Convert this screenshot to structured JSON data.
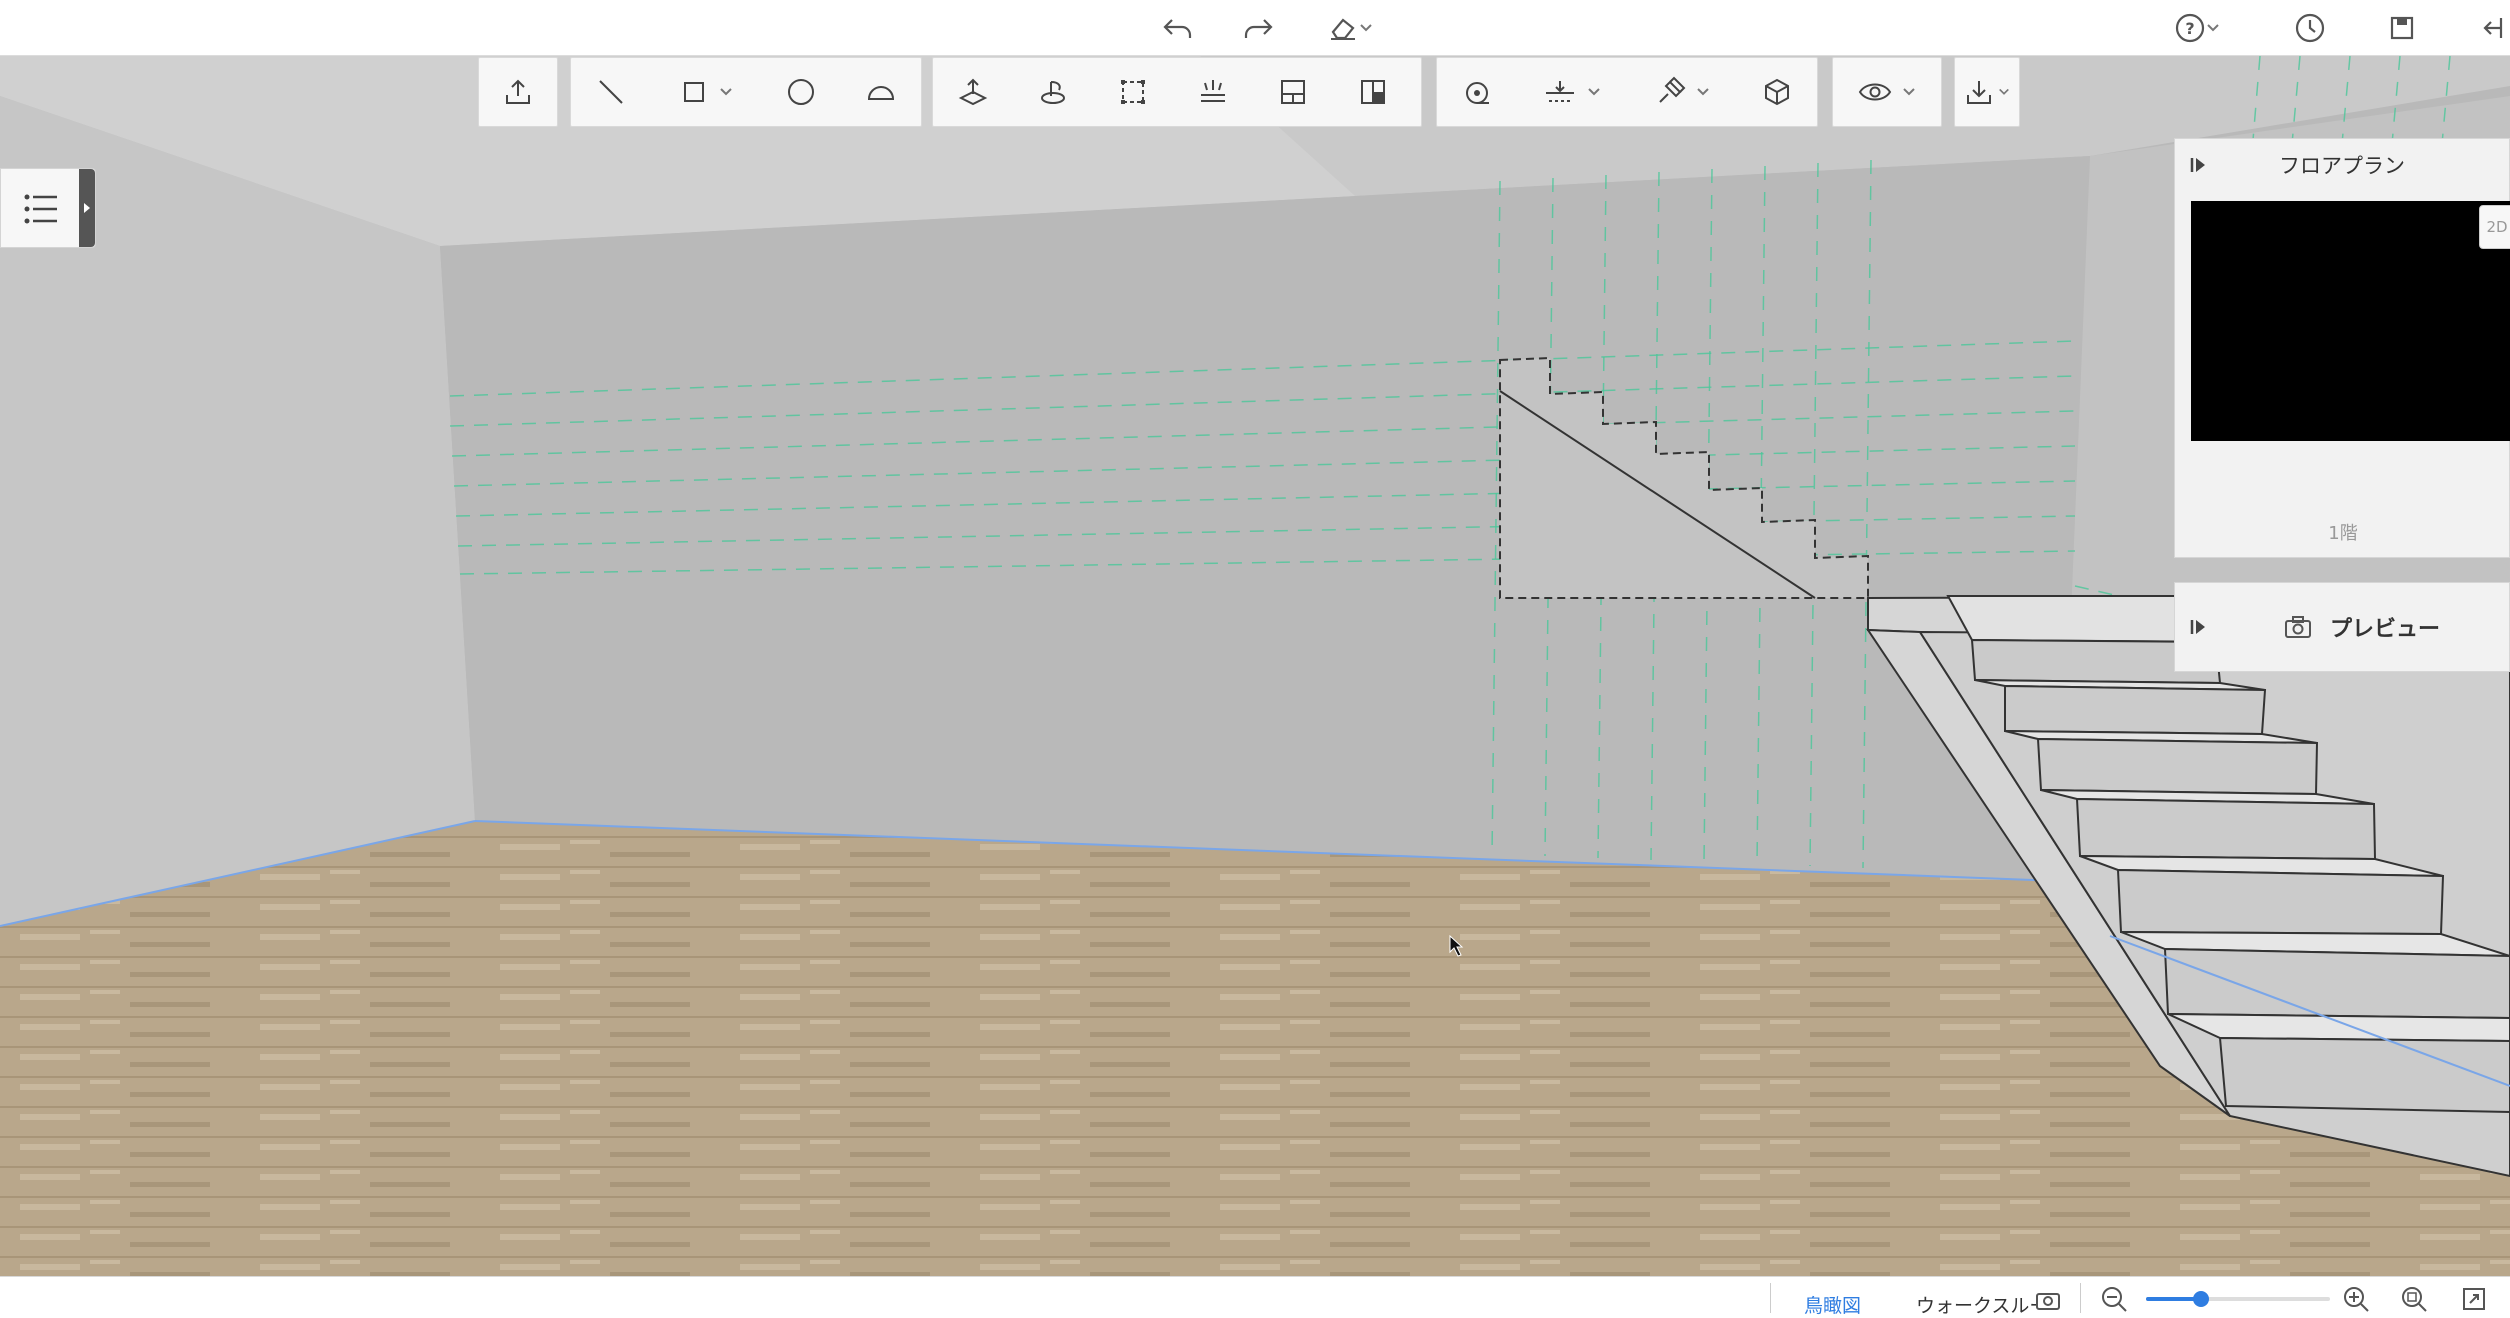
{
  "topbar": {
    "icons": [
      "undo-icon",
      "redo-icon",
      "eraser-icon",
      "help-icon",
      "history-icon",
      "save-icon",
      "exit-icon"
    ]
  },
  "toolbar": {
    "groups": [
      [
        "upload-icon"
      ],
      [
        "line-icon",
        "rectangle-icon",
        "circle-icon",
        "arc-icon"
      ],
      [
        "push-pull-icon",
        "rotate-icon",
        "select-area-icon",
        "light-icon",
        "wall-panel-icon",
        "texture-icon"
      ],
      [
        "measure-icon",
        "align-icon",
        "paint-icon",
        "cube-icon"
      ],
      [
        "eye-icon"
      ],
      [
        "download-icon"
      ]
    ]
  },
  "floorplan_panel": {
    "title": "フロアプラン",
    "mode_label": "2D",
    "floor_label": "1階"
  },
  "preview_panel": {
    "title": "プレビュー"
  },
  "statusbar": {
    "view_birdseye": "鳥瞰図",
    "view_walkthrough": "ウォークスルー",
    "zoom_level": 0.3
  },
  "colors": {
    "accent": "#2f7de1",
    "floor": "#b8a68a",
    "wall": "#bdbdbd",
    "guide": "#3fbf8f"
  }
}
